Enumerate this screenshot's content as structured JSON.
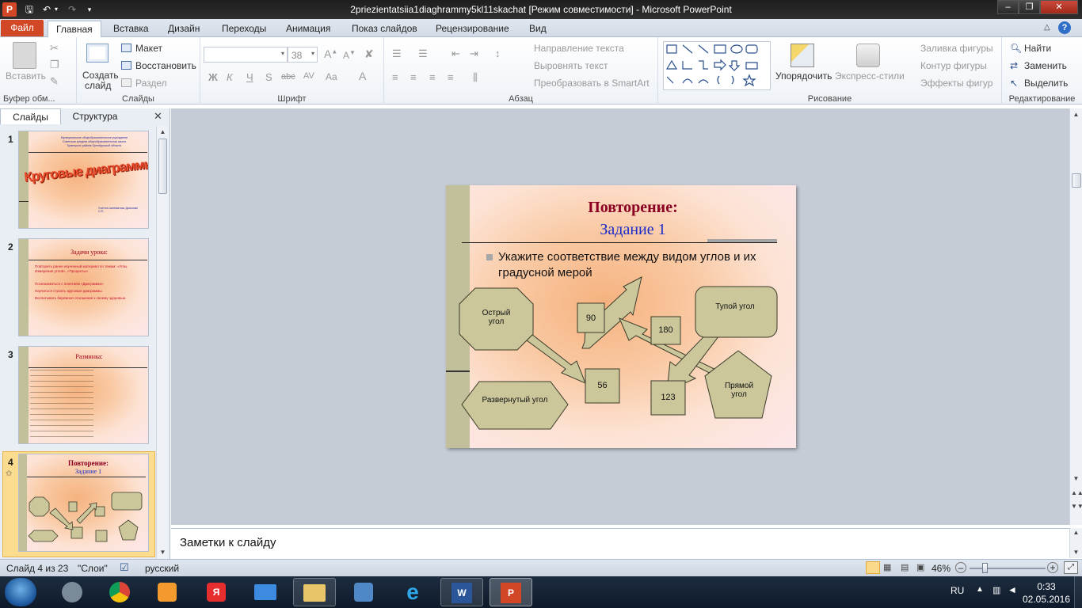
{
  "window": {
    "title": "2priezientatsiia1diaghrammy5kl11skachat [Режим совместимости] - Microsoft PowerPoint"
  },
  "tabs": [
    {
      "label": "Файл"
    },
    {
      "label": "Главная"
    },
    {
      "label": "Вставка"
    },
    {
      "label": "Дизайн"
    },
    {
      "label": "Переходы"
    },
    {
      "label": "Анимация"
    },
    {
      "label": "Показ слайдов"
    },
    {
      "label": "Рецензирование"
    },
    {
      "label": "Вид"
    }
  ],
  "ribbon": {
    "clipboard": {
      "paste": "Вставить",
      "label": "Буфер обм..."
    },
    "slides": {
      "new_slide_1": "Создать",
      "new_slide_2": "слайд",
      "layout": "Макет",
      "reset": "Восстановить",
      "section": "Раздел",
      "label": "Слайды"
    },
    "font": {
      "size": "38",
      "bold": "Ж",
      "italic": "К",
      "underline": "Ч",
      "shadow": "S",
      "strike": "abc",
      "spacing": "AV",
      "case": "Aa",
      "label": "Шрифт"
    },
    "paragraph": {
      "text_direction": "Направление текста",
      "align_text": "Выровнять текст",
      "smartart": "Преобразовать в SmartArt",
      "label": "Абзац"
    },
    "drawing": {
      "arrange": "Упорядочить",
      "quick_styles": "Экспресс-стили",
      "fill": "Заливка фигуры",
      "outline": "Контур фигуры",
      "effects": "Эффекты фигур",
      "label": "Рисование"
    },
    "editing": {
      "find": "Найти",
      "replace": "Заменить",
      "select": "Выделить",
      "label": "Редактирование"
    }
  },
  "panel": {
    "tab_slides": "Слайды",
    "tab_outline": "Структура",
    "thumbs": [
      {
        "num": "1",
        "title": "Круговые диаграммы",
        "lines": [
          "Муниципальное общеобразовательное учреждение",
          "Советская средняя общеобразовательная школа",
          "Кузнецкого района Оренбургской области"
        ],
        "author": "Учитель математики Дьячкова О.П."
      },
      {
        "num": "2",
        "title": "Задачи урока:",
        "bullets": [
          "Повторить ранее изученный материал по темам: «Углы. Измерение углов», «Проценты»",
          "Познакомиться с понятием «Диаграмма».",
          "Научиться строить круговые диаграммы.",
          "Воспитывать бережное отношение к своему здоровью."
        ]
      },
      {
        "num": "3",
        "title": "Разминка:"
      },
      {
        "num": "4",
        "title": "Повторение:",
        "subtitle": "Задание 1"
      }
    ]
  },
  "slide": {
    "title": "Повторение:",
    "subtitle": "Задание 1",
    "bullet": "Укажите соответствие между  видом углов и их градусной мерой",
    "shapes": {
      "acute": "Острый угол",
      "obtuse": "Тупой угол",
      "straight": "Развернутый угол",
      "right": "Прямой угол",
      "n90": "90",
      "n180": "180",
      "n56": "56",
      "n123": "123"
    }
  },
  "notes": {
    "placeholder": "Заметки к слайду"
  },
  "status": {
    "slide_info": "Слайд 4 из 23",
    "theme": "\"Слои\"",
    "language": "русский",
    "zoom": "46%",
    "zoom_fraction": 0.46
  },
  "taskbar": {
    "lang": "RU",
    "time": "0:33",
    "date": "02.05.2016"
  },
  "colors": {
    "accent_file_tab": "#d24726",
    "slide_title": "#8b0022",
    "slide_subtitle": "#1a2bc8",
    "shape_fill": "#cbc79b",
    "shape_stroke": "#3b3b2a"
  }
}
